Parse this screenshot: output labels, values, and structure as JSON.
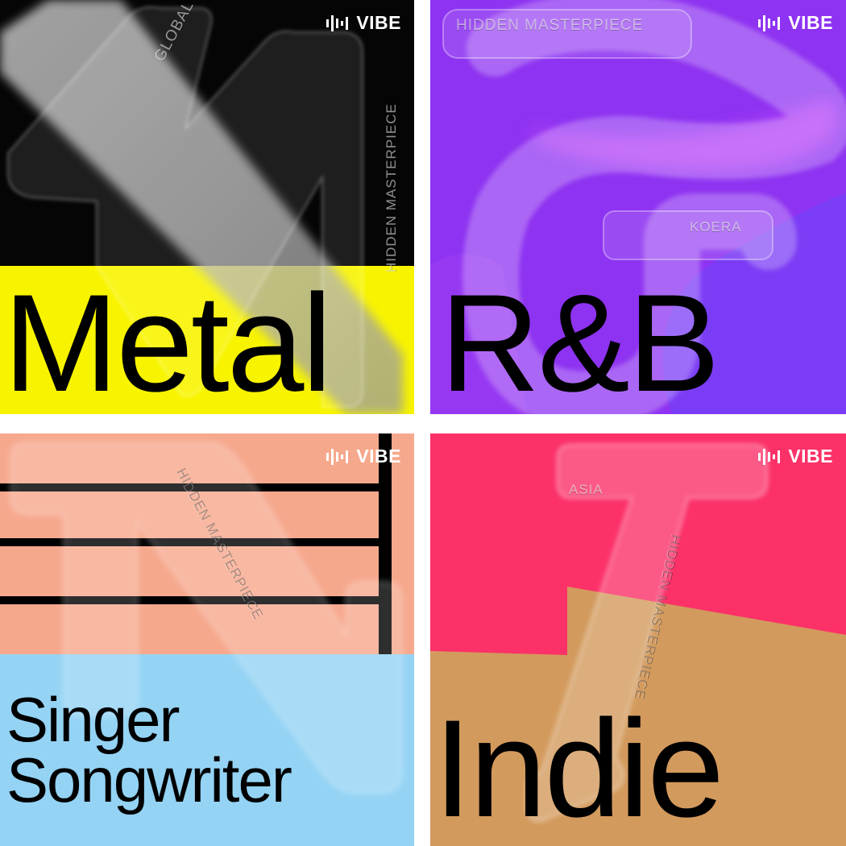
{
  "brand": {
    "name": "VIBE",
    "icon": "equalizer-bars-icon"
  },
  "tiles": [
    {
      "genre": "Metal",
      "region": "GLOBAL",
      "series": "HIDDEN MASTERPIECE",
      "colors": {
        "bg": "#050505",
        "band": "#f8f400"
      }
    },
    {
      "genre": "R&B",
      "region": "KOERA",
      "series": "HIDDEN MASTERPIECE",
      "colors": {
        "bg": "#8e33f1",
        "shape": "#7b3cf5"
      }
    },
    {
      "genre_line1": "Singer",
      "genre_line2": "Songwriter",
      "series": "HIDDEN MASTERPIECE",
      "colors": {
        "stripes": "#f6a88d",
        "bottom": "#94d3f4"
      }
    },
    {
      "genre": "Indie",
      "region": "ASIA",
      "series": "HIDDEN MASTERPIECE",
      "colors": {
        "top": "#fb3168",
        "bottom": "#d39a5d"
      }
    }
  ]
}
